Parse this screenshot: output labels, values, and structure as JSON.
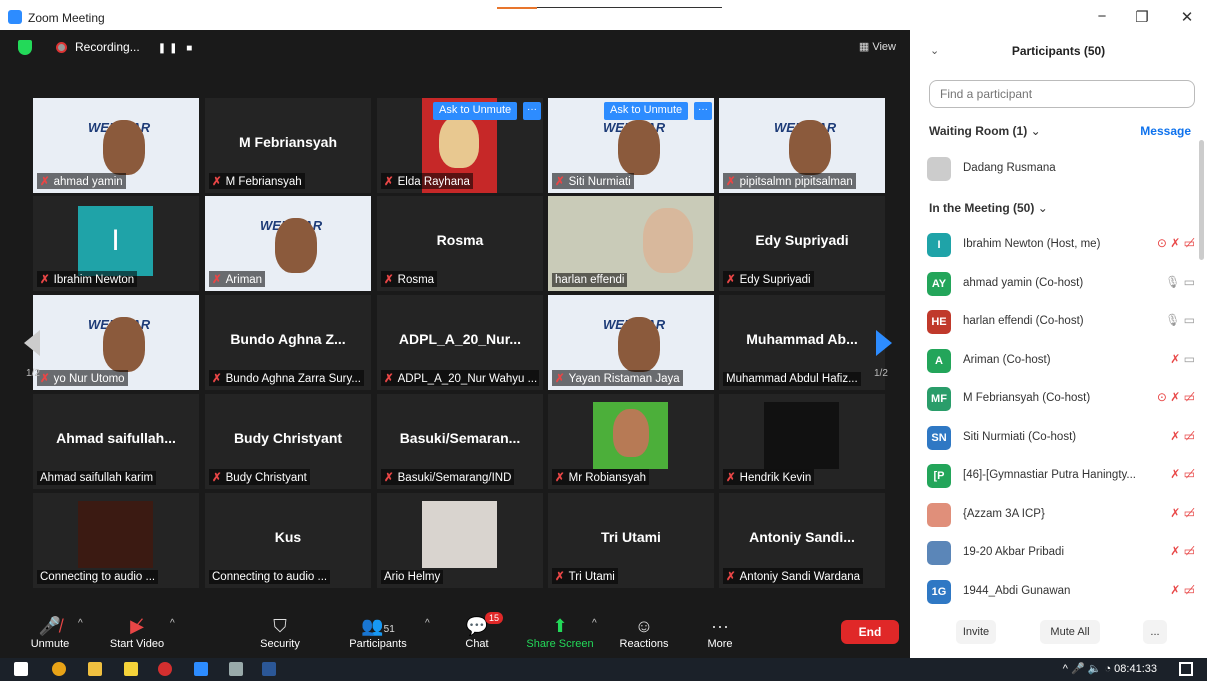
{
  "window": {
    "title": "Zoom Meeting"
  },
  "topbar": {
    "recording_label": "Recording...",
    "view_label": "View"
  },
  "tiles": [
    {
      "name": "ahmad yamin",
      "center": "",
      "kind": "webinar",
      "active": true
    },
    {
      "name": "M Febriansyah",
      "center": "M Febriansyah",
      "kind": "blank"
    },
    {
      "name": "Elda Rayhana",
      "center": "",
      "kind": "photo-red",
      "ask": true
    },
    {
      "name": "Siti Nurmiati",
      "center": "",
      "kind": "webinar",
      "ask": true
    },
    {
      "name": "pipitsalmn pipitsalman",
      "center": "",
      "kind": "webinar"
    },
    {
      "name": "Ibrahim Newton",
      "center": "",
      "kind": "avatar-I"
    },
    {
      "name": "Ariman",
      "center": "",
      "kind": "webinar"
    },
    {
      "name": "Rosma",
      "center": "Rosma",
      "kind": "blank"
    },
    {
      "name": "harlan effendi",
      "center": "",
      "kind": "room"
    },
    {
      "name": "Edy Supriyadi",
      "center": "Edy Supriyadi",
      "kind": "blank"
    },
    {
      "name": "yo Nur Utomo",
      "center": "",
      "kind": "webinar"
    },
    {
      "name": "Bundo Aghna Zarra Sury...",
      "center": "Bundo Aghna Z...",
      "kind": "blank"
    },
    {
      "name": "ADPL_A_20_Nur Wahyu ...",
      "center": "ADPL_A_20_Nur...",
      "kind": "blank"
    },
    {
      "name": "Yayan Ristaman Jaya",
      "center": "",
      "kind": "webinar"
    },
    {
      "name": "Muhammad Abdul Hafiz...",
      "center": "Muhammad Ab...",
      "kind": "blank"
    },
    {
      "name": "Ahmad saifullah karim",
      "center": "Ahmad saifullah...",
      "kind": "blank"
    },
    {
      "name": "Budy Christyant",
      "center": "Budy Christyant",
      "kind": "blank"
    },
    {
      "name": "Basuki/Semarang/IND",
      "center": "Basuki/Semaran...",
      "kind": "blank"
    },
    {
      "name": "Mr Robiansyah",
      "center": "",
      "kind": "photo-green"
    },
    {
      "name": "Hendrik Kevin",
      "center": "",
      "kind": "angel"
    },
    {
      "name": "Connecting to audio ...",
      "center": "",
      "kind": "dark"
    },
    {
      "name": "Connecting to audio ...",
      "center": "Kus",
      "kind": "blank"
    },
    {
      "name": "Ario Helmy",
      "center": "",
      "kind": "group"
    },
    {
      "name": "Tri Utami",
      "center": "Tri Utami",
      "kind": "blank"
    },
    {
      "name": "Antoniy Sandi Wardana",
      "center": "Antoniy Sandi...",
      "kind": "blank"
    }
  ],
  "ask_label": "Ask to Unmute",
  "webinar_word": "WEBINAR",
  "page_indicator": "1/2",
  "toolbar": {
    "unmute": "Unmute",
    "start_video": "Start Video",
    "security": "Security",
    "participants": "Participants",
    "participants_count": "51",
    "chat": "Chat",
    "chat_badge": "15",
    "share_screen": "Share Screen",
    "reactions": "Reactions",
    "more": "More",
    "end": "End"
  },
  "panel": {
    "title": "Participants (50)",
    "search_placeholder": "Find a participant",
    "waiting_room": "Waiting Room (1)",
    "message": "Message",
    "waiting_person": "Dadang Rusmana",
    "in_meeting": "In the Meeting (50)",
    "participants": [
      {
        "initials": "I",
        "name": "Ibrahim Newton (Host, me)",
        "color": "#1fa3a8"
      },
      {
        "initials": "AY",
        "name": "ahmad yamin (Co-host)",
        "color": "#23a55a"
      },
      {
        "initials": "HE",
        "name": "harlan effendi (Co-host)",
        "color": "#c0392b"
      },
      {
        "initials": "A",
        "name": "Ariman (Co-host)",
        "color": "#23a55a"
      },
      {
        "initials": "MF",
        "name": "M Febriansyah (Co-host)",
        "color": "#2a9d6a"
      },
      {
        "initials": "SN",
        "name": "Siti Nurmiati (Co-host)",
        "color": "#2f78c4"
      },
      {
        "initials": "[P",
        "name": "[46]-[Gymnastiar Putra Haningty...",
        "color": "#23a55a"
      },
      {
        "initials": "",
        "name": "{Azzam 3A ICP}",
        "color": "#e08f7a"
      },
      {
        "initials": "",
        "name": "19-20 Akbar Pribadi",
        "color": "#5b86b8"
      },
      {
        "initials": "1G",
        "name": "1944_Abdi Gunawan",
        "color": "#2f78c4"
      }
    ],
    "invite": "Invite",
    "mute_all": "Mute All",
    "more": "..."
  },
  "taskbar": {
    "time": "08:41:33"
  }
}
